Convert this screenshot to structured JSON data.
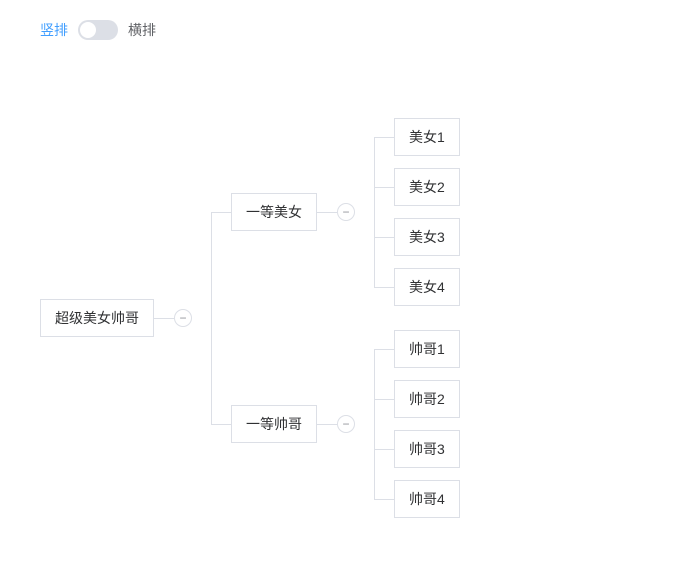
{
  "toggle": {
    "active_label": "竖排",
    "inactive_label": "横排",
    "on": false
  },
  "tree": {
    "label": "超级美女帅哥",
    "expand_glyph": "−",
    "children": [
      {
        "label": "一等美女",
        "expand_glyph": "−",
        "children": [
          {
            "label": "美女1"
          },
          {
            "label": "美女2"
          },
          {
            "label": "美女3"
          },
          {
            "label": "美女4"
          }
        ]
      },
      {
        "label": "一等帅哥",
        "expand_glyph": "−",
        "children": [
          {
            "label": "帅哥1"
          },
          {
            "label": "帅哥2"
          },
          {
            "label": "帅哥3"
          },
          {
            "label": "帅哥4"
          }
        ]
      }
    ]
  }
}
